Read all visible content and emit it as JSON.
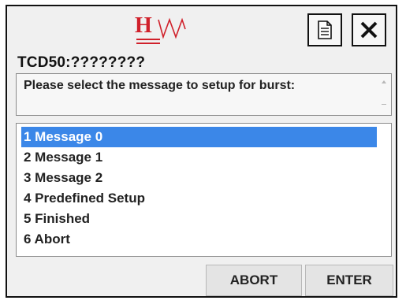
{
  "header": {
    "logo_letter": "H",
    "device_title": "TCD50:????????"
  },
  "toolbar": {
    "document_icon": "document-icon",
    "close_icon": "close-icon"
  },
  "prompt": {
    "text": "Please select the message to setup for burst:"
  },
  "menu": {
    "items": [
      {
        "label": "1 Message 0",
        "selected": true
      },
      {
        "label": "2 Message 1",
        "selected": false
      },
      {
        "label": "3 Message 2",
        "selected": false
      },
      {
        "label": "4 Predefined Setup",
        "selected": false
      },
      {
        "label": "5 Finished",
        "selected": false
      },
      {
        "label": "6 Abort",
        "selected": false
      }
    ]
  },
  "buttons": {
    "abort_label": "ABORT",
    "enter_label": "ENTER"
  },
  "colors": {
    "logo": "#d0202a",
    "selection": "#3b87e8",
    "background": "#f0f0f0"
  }
}
